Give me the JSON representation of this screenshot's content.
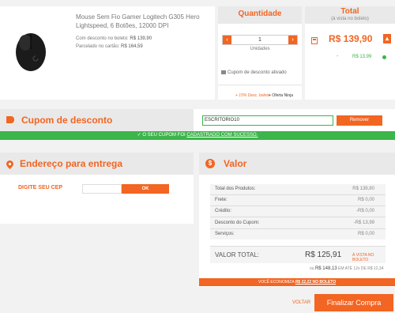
{
  "product": {
    "name": "Mouse Sem Fio Gamer Logitech G305 Hero Lightspeed, 6 Botões, 12000 DPI",
    "cash_label": "Com desconto no boleto:",
    "cash_price": "R$ 139,90",
    "card_label": "Parcelado no cartão:",
    "card_price": "R$ 164,59"
  },
  "quantity": {
    "header": "Quantidade",
    "value": "1",
    "unit_label": "Unidades",
    "coupon_active": "Cupom de desconto ativado",
    "discount_tag": "+ 15% Desc. boleto",
    "offer_tag": "+ Oferta Ninja"
  },
  "total": {
    "header": "Total",
    "subheader": "(à vista no boleto)",
    "price": "R$ 139,90",
    "saving_mark": "-",
    "saving_value": "R$ 13,99"
  },
  "coupon": {
    "title": "Cupom de desconto",
    "code": "ESCRITORIO10",
    "remove_label": "Remover",
    "banner_prefix": "✓ O SEU CUPOM FOI",
    "banner_link": "CADASTRADO COM SUCESSO."
  },
  "address": {
    "title": "Endereço para entrega",
    "cep_label": "DIGITE SEU CEP",
    "cep_value": "",
    "ok_label": "OK"
  },
  "summary": {
    "title": "Valor",
    "rows": [
      {
        "label": "Total dos Produtos:",
        "value": "R$ 139,90"
      },
      {
        "label": "Frete:",
        "value": "R$ 0,00"
      },
      {
        "label": "Crédito:",
        "value": "-R$ 0,00"
      },
      {
        "label": "Desconto do Cupom:",
        "value": "-R$ 13,99"
      },
      {
        "label": "Serviços:",
        "value": "R$ 0,00"
      }
    ],
    "total_label": "VALOR TOTAL:",
    "total_value": "R$ 125,91",
    "total_note": "À VISTA NO BOLETO",
    "alt_prefix": "ou",
    "alt_value": "R$ 148,13",
    "alt_note": "EM ATÉ 12x DE R$ 12,34",
    "economy_prefix": "VOCÊ ECONOMIZA",
    "economy_value": "R$ 22,22 NO BOLETO"
  },
  "footer": {
    "back_label": "VOLTAR",
    "finish_label": "Finalizar Compra"
  },
  "colors": {
    "accent": "#f26522",
    "success": "#3cb54a"
  }
}
